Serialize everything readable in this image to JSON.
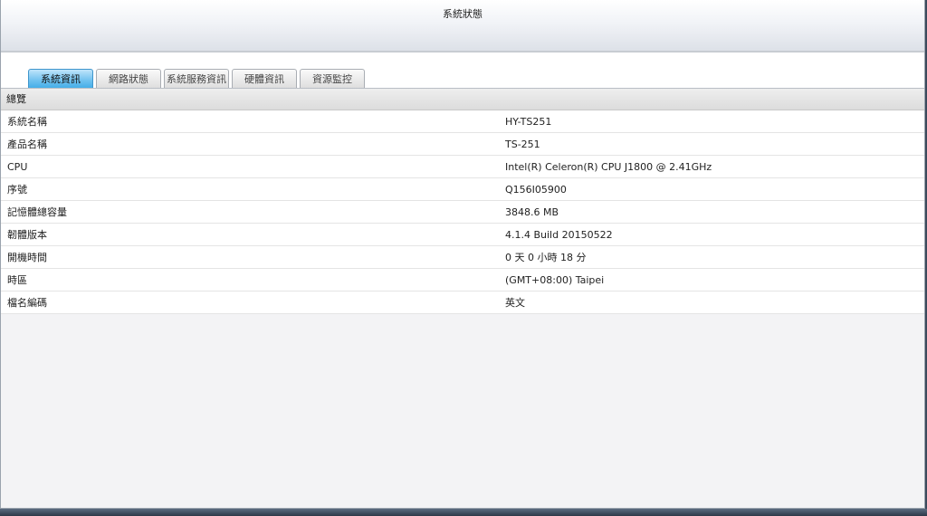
{
  "window": {
    "title": "系統狀態"
  },
  "tabs": [
    {
      "label": "系統資訊",
      "active": true
    },
    {
      "label": "網路狀態",
      "active": false
    },
    {
      "label": "系統服務資訊",
      "active": false
    },
    {
      "label": "硬體資訊",
      "active": false
    },
    {
      "label": "資源監控",
      "active": false
    }
  ],
  "section": {
    "title": "總覽"
  },
  "rows": [
    {
      "label": "系統名稱",
      "value": "HY-TS251"
    },
    {
      "label": "產品名稱",
      "value": "TS-251"
    },
    {
      "label": "CPU",
      "value": "Intel(R) Celeron(R) CPU J1800 @ 2.41GHz"
    },
    {
      "label": "序號",
      "value": "Q156I05900"
    },
    {
      "label": "記憶體總容量",
      "value": "3848.6 MB"
    },
    {
      "label": "韌體版本",
      "value": "4.1.4 Build 20150522"
    },
    {
      "label": "開機時間",
      "value": "0 天 0 小時 18 分"
    },
    {
      "label": "時區",
      "value": "(GMT+08:00) Taipei"
    },
    {
      "label": "檔名編碼",
      "value": "英文"
    }
  ]
}
